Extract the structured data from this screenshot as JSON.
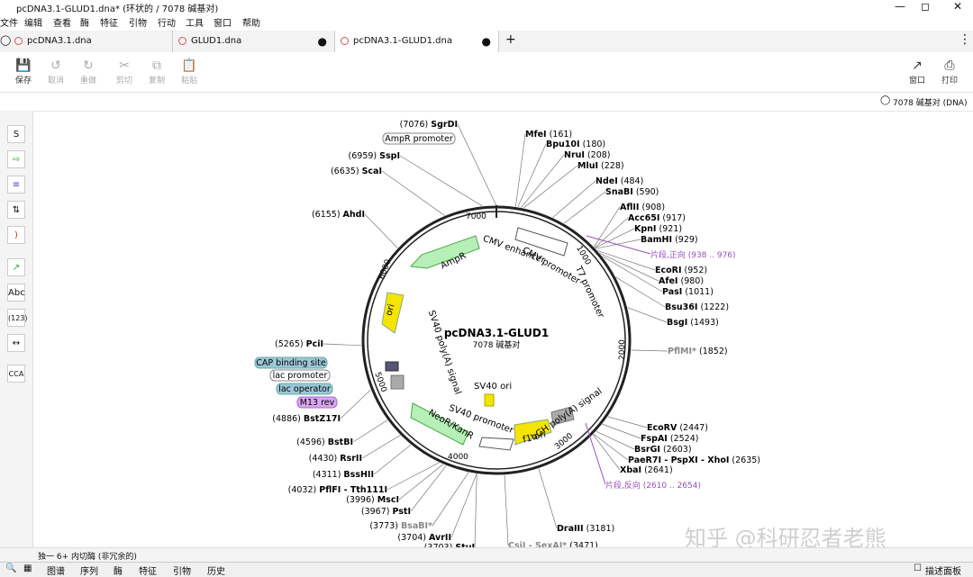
{
  "window": {
    "title": "pcDNA3.1-GLUD1.dna*  (环状的 / 7078 碱基对)"
  },
  "menu": [
    "文件",
    "编辑",
    "查看",
    "酶",
    "特征",
    "引物",
    "行动",
    "工具",
    "窗口",
    "帮助"
  ],
  "tabs": [
    {
      "label": "pcDNA3.1.dna",
      "active": false
    },
    {
      "label": "GLUD1.dna",
      "active": false
    },
    {
      "label": "pcDNA3.1-GLUD1.dna",
      "active": true
    }
  ],
  "toolbar": {
    "save": "保存",
    "undo": "取消",
    "redo": "重做",
    "cut": "剪切",
    "copy": "复制",
    "paste": "粘贴",
    "window": "窗口",
    "print": "打印"
  },
  "status": {
    "topology": "7078 碱基对 (DNA)"
  },
  "map": {
    "name": "pcDNA3.1-GLUD1",
    "size": "7078 碱基对",
    "ticks": [
      "1000",
      "2000",
      "3000",
      "4000",
      "5000",
      "6000",
      "7000"
    ],
    "features": [
      "CMV enhancer",
      "CMV promoter",
      "T7 promoter",
      "AmpR",
      "ori",
      "SV40 poly(A) signal",
      "SV40 ori",
      "SV40 promoter",
      "NeoR/KanR",
      "f1 ori",
      "bGH poly(A) signal"
    ],
    "left_features": [
      "CAP binding site",
      "lac promoter",
      "lac operator",
      "M13 rev",
      "AmpR promoter"
    ],
    "sites": [
      {
        "pos": "(7076)",
        "name": "SgrDI"
      },
      {
        "pos": "(6959)",
        "name": "SspI"
      },
      {
        "pos": "(6635)",
        "name": "ScaI"
      },
      {
        "pos": "(6155)",
        "name": "AhdI"
      },
      {
        "pos": "(5265)",
        "name": "PciI"
      },
      {
        "pos": "(4886)",
        "name": "BstZ17I"
      },
      {
        "pos": "(4596)",
        "name": "BstBI"
      },
      {
        "pos": "(4430)",
        "name": "RsrII"
      },
      {
        "pos": "(4311)",
        "name": "BssHII"
      },
      {
        "pos": "(4032)",
        "name": "PflFI - Tth111I"
      },
      {
        "pos": "(3996)",
        "name": "MscI"
      },
      {
        "pos": "(3967)",
        "name": "PstI"
      },
      {
        "pos": "(3773)",
        "name": "BsaBI*"
      },
      {
        "pos": "(3704)",
        "name": "AvrII"
      },
      {
        "pos": "(3703)",
        "name": "StuI"
      },
      {
        "name": "MfeI",
        "pos": "(161)"
      },
      {
        "name": "Bpu10I",
        "pos": "(180)"
      },
      {
        "name": "NruI",
        "pos": "(208)"
      },
      {
        "name": "MluI",
        "pos": "(228)"
      },
      {
        "name": "NdeI",
        "pos": "(484)"
      },
      {
        "name": "SnaBI",
        "pos": "(590)"
      },
      {
        "name": "AflII",
        "pos": "(908)"
      },
      {
        "name": "Acc65I",
        "pos": "(917)"
      },
      {
        "name": "KpnI",
        "pos": "(921)"
      },
      {
        "name": "BamHI",
        "pos": "(929)"
      },
      {
        "name": "EcoRI",
        "pos": "(952)"
      },
      {
        "name": "AfeI",
        "pos": "(980)"
      },
      {
        "name": "PasI",
        "pos": "(1011)"
      },
      {
        "name": "Bsu36I",
        "pos": "(1222)"
      },
      {
        "name": "BsgI",
        "pos": "(1493)"
      },
      {
        "name": "PflMI*",
        "pos": "(1852)"
      },
      {
        "name": "EcoRV",
        "pos": "(2447)"
      },
      {
        "name": "FspAI",
        "pos": "(2524)"
      },
      {
        "name": "BsrGI",
        "pos": "(2603)"
      },
      {
        "name": "PaeR7I - PspXI - XhoI",
        "pos": "(2635)"
      },
      {
        "name": "XbaI",
        "pos": "(2641)"
      },
      {
        "name": "DraIII",
        "pos": "(3181)"
      },
      {
        "name": "CsiI - SexAI*",
        "pos": "(3471)"
      }
    ],
    "fragment_fwd": "片段,正向 (938 .. 976)",
    "fragment_rev": "片段,反向 (2610 .. 2654)"
  },
  "bottom": {
    "left": "独一 6+ 内切酶 (非冗余的)",
    "watermark": "知乎 @科研忍者老熊"
  },
  "viewtabs": [
    "图谱",
    "序列",
    "酶",
    "特征",
    "引物",
    "历史"
  ],
  "describe_panel": "描述面板",
  "colors": {
    "ampr": "#b6f0b6",
    "ori": "#f5e400",
    "feature_outline": "#555",
    "fragment": "#9b4fc0"
  }
}
